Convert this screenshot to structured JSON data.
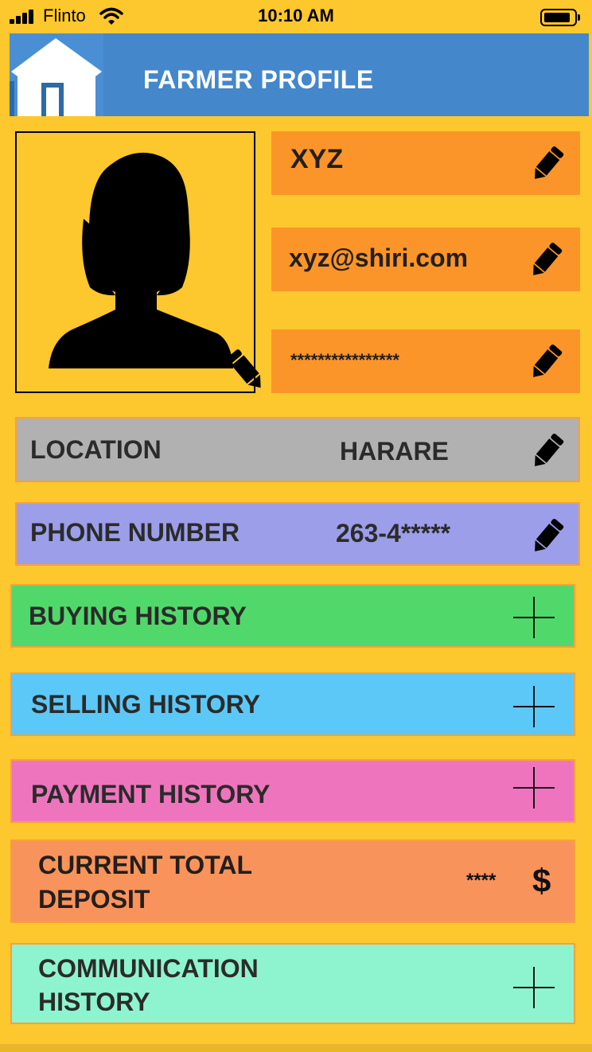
{
  "status_bar": {
    "carrier": "Flinto",
    "time": "10:10 AM"
  },
  "header": {
    "title": "FARMER PROFILE",
    "home_icon": "home-icon"
  },
  "profile": {
    "name": "XYZ",
    "email": "xyz@shiri.com",
    "password": "****************"
  },
  "location": {
    "label": "LOCATION",
    "value": "HARARE"
  },
  "phone": {
    "label": "PHONE NUMBER",
    "value": "263-4*****"
  },
  "sections": {
    "buying": "BUYING HISTORY",
    "selling": "SELLING HISTORY",
    "payment": "PAYMENT HISTORY",
    "deposit_line1": "CURRENT TOTAL",
    "deposit_line2": "DEPOSIT",
    "deposit_value": "****",
    "deposit_currency": "$",
    "communication_line1": "COMMUNICATION",
    "communication_line2": "HISTORY"
  },
  "colors": {
    "background": "#fdc72e",
    "header": "#4487cb",
    "field": "#fb9529",
    "location": "#b1b1b1",
    "phone": "#9c9eea",
    "buying": "#51d86a",
    "selling": "#5cc8f7",
    "payment": "#ee75bd",
    "deposit": "#f9935c",
    "communication": "#8ef4cf"
  }
}
